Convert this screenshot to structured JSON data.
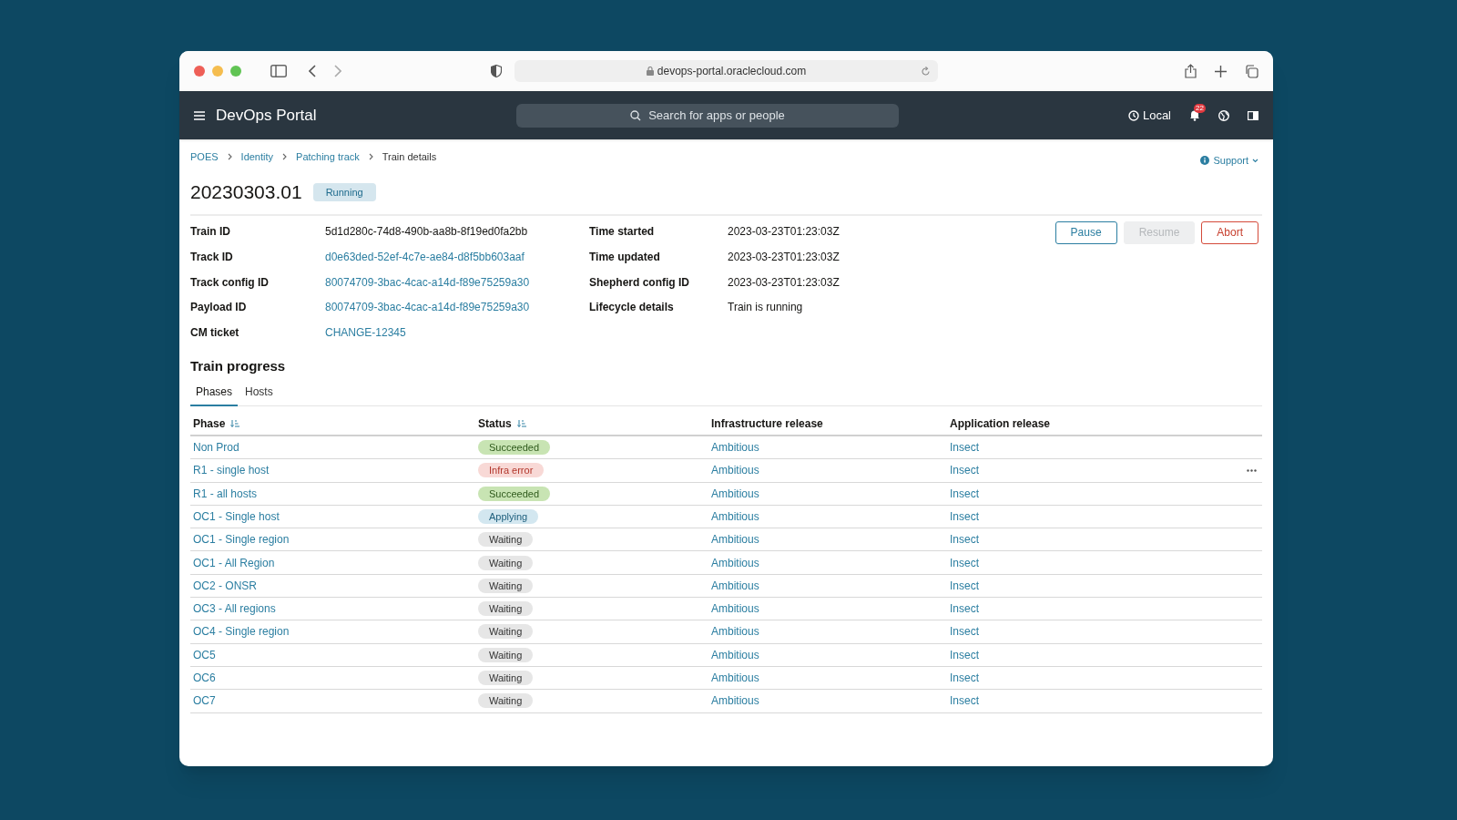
{
  "browser": {
    "url": "devops-portal.oraclecloud.com"
  },
  "app_header": {
    "title": "DevOps Portal",
    "search_placeholder": "Search for apps or people",
    "timezone": "Local",
    "notification_count": "22"
  },
  "breadcrumbs": [
    {
      "label": "POES",
      "current": false
    },
    {
      "label": "Identity",
      "current": false
    },
    {
      "label": "Patching track",
      "current": false
    },
    {
      "label": "Train details",
      "current": true
    }
  ],
  "support": "Support",
  "page": {
    "title": "20230303.01",
    "status": "Running"
  },
  "details_left": [
    {
      "label": "Train ID",
      "value": "5d1d280c-74d8-490b-aa8b-8f19ed0fa2bb",
      "kind": "text"
    },
    {
      "label": "Track ID",
      "value": "d0e63ded-52ef-4c7e-ae84-d8f5bb603aaf",
      "kind": "link"
    },
    {
      "label": "Track config ID",
      "value": "80074709-3bac-4cac-a14d-f89e75259a30",
      "kind": "link"
    },
    {
      "label": "Payload ID",
      "value": "80074709-3bac-4cac-a14d-f89e75259a30",
      "kind": "link"
    },
    {
      "label": "CM ticket",
      "value": "CHANGE-12345",
      "kind": "link"
    }
  ],
  "details_right": [
    {
      "label": "Time started",
      "value": "2023-03-23T01:23:03Z"
    },
    {
      "label": "Time updated",
      "value": "2023-03-23T01:23:03Z"
    },
    {
      "label": "Shepherd config ID",
      "value": "2023-03-23T01:23:03Z"
    },
    {
      "label": "Lifecycle details",
      "value": "Train is running"
    }
  ],
  "actions": [
    {
      "label": "Pause",
      "kind": "primary",
      "disabled": false
    },
    {
      "label": "Resume",
      "disabled": true
    },
    {
      "label": "Abort",
      "kind": "danger",
      "disabled": false
    }
  ],
  "progress": {
    "title": "Train progress",
    "tabs": [
      {
        "label": "Phases",
        "selected": true
      },
      {
        "label": "Hosts",
        "selected": false
      }
    ],
    "table": {
      "columns": [
        {
          "label": "Phase",
          "sortable": true
        },
        {
          "label": "Status",
          "sortable": true
        },
        {
          "label": "Infrastructure release",
          "sortable": false
        },
        {
          "label": "Application release",
          "sortable": false
        }
      ],
      "rows": [
        {
          "phase": "Non Prod",
          "status": "Succeeded",
          "kind": "success",
          "infra": "Ambitious",
          "app": "Insect",
          "menu": false
        },
        {
          "phase": "R1 - single host",
          "status": "Infra error",
          "kind": "error",
          "infra": "Ambitious",
          "app": "Insect",
          "menu": true
        },
        {
          "phase": "R1 - all hosts",
          "status": "Succeeded",
          "kind": "success",
          "infra": "Ambitious",
          "app": "Insect",
          "menu": false
        },
        {
          "phase": "OC1 - Single host",
          "status": "Applying",
          "kind": "info",
          "infra": "Ambitious",
          "app": "Insect",
          "menu": false
        },
        {
          "phase": "OC1 - Single region",
          "status": "Waiting",
          "kind": "neutral",
          "infra": "Ambitious",
          "app": "Insect",
          "menu": false
        },
        {
          "phase": "OC1 - All Region",
          "status": "Waiting",
          "kind": "neutral",
          "infra": "Ambitious",
          "app": "Insect",
          "menu": false
        },
        {
          "phase": "OC2 - ONSR",
          "status": "Waiting",
          "kind": "neutral",
          "infra": "Ambitious",
          "app": "Insect",
          "menu": false
        },
        {
          "phase": "OC3 - All regions",
          "status": "Waiting",
          "kind": "neutral",
          "infra": "Ambitious",
          "app": "Insect",
          "menu": false
        },
        {
          "phase": "OC4 - Single region",
          "status": "Waiting",
          "kind": "neutral",
          "infra": "Ambitious",
          "app": "Insect",
          "menu": false
        },
        {
          "phase": "OC5",
          "status": "Waiting",
          "kind": "neutral",
          "infra": "Ambitious",
          "app": "Insect",
          "menu": false
        },
        {
          "phase": "OC6",
          "status": "Waiting",
          "kind": "neutral",
          "infra": "Ambitious",
          "app": "Insect",
          "menu": false
        },
        {
          "phase": "OC7",
          "status": "Waiting",
          "kind": "neutral",
          "infra": "Ambitious",
          "app": "Insect",
          "menu": false
        }
      ]
    }
  }
}
